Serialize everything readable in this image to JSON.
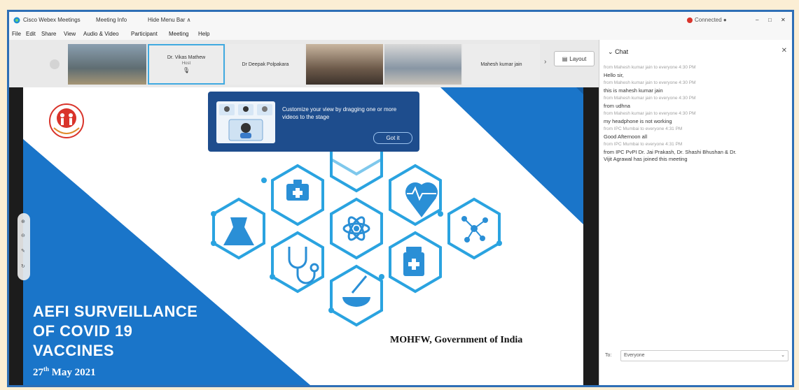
{
  "window": {
    "app_title": "Cisco Webex Meetings",
    "meeting_info": "Meeting Info",
    "hide_menu_bar": "Hide Menu Bar ∧",
    "status": "Connected ●",
    "min": "–",
    "max": "□",
    "close": "✕"
  },
  "menu": [
    "File",
    "Edit",
    "Share",
    "View",
    "Audio & Video",
    "Participant",
    "Meeting",
    "Help"
  ],
  "participants": {
    "tile2": "Dr. Vikas Mathew",
    "tile2_sub": "Host",
    "tile3": "Dr Deepak Polpakara",
    "tile6": "Mahesh kumar jain",
    "layout_label": "Layout"
  },
  "chat": {
    "header": "Chat",
    "messages": [
      {
        "meta": "from Mahesh kumar jain to everyone   4:30 PM",
        "text": "Hello sir,"
      },
      {
        "meta": "from Mahesh kumar jain to everyone   4:30 PM",
        "text": "this is mahesh kumar jain"
      },
      {
        "meta": "from Mahesh kumar jain to everyone   4:30 PM",
        "text": "from udhna"
      },
      {
        "meta": "from Mahesh kumar jain to everyone   4:30 PM",
        "text": "my headphone is not working"
      },
      {
        "meta": "from IPC Mumbai to everyone   4:31 PM",
        "text": "Good Afternoon all"
      },
      {
        "meta": "from IPC Mumbai to everyone   4:31 PM",
        "text": "from IPC PvPI Dr. Jai Prakash, Dr. Shashi Bhushan & Dr."
      },
      {
        "meta": "",
        "text": "Vijit Agrawal has joined this meeting"
      }
    ],
    "to_label": "To:",
    "to_value": "Everyone"
  },
  "tooltip": {
    "text": "Customize your view by dragging one or more videos to the stage",
    "button": "Got it"
  },
  "slide": {
    "title_line1": "AEFI SURVEILLANCE",
    "title_line2": "OF COVID 19",
    "title_line3": "VACCINES",
    "date_day": "27",
    "date_suffix": "th",
    "date_rest": " May 2021",
    "footer": "MOHFW, Government of India",
    "accent": "#1a75c9",
    "hex_stroke": "#2aa3e0"
  }
}
